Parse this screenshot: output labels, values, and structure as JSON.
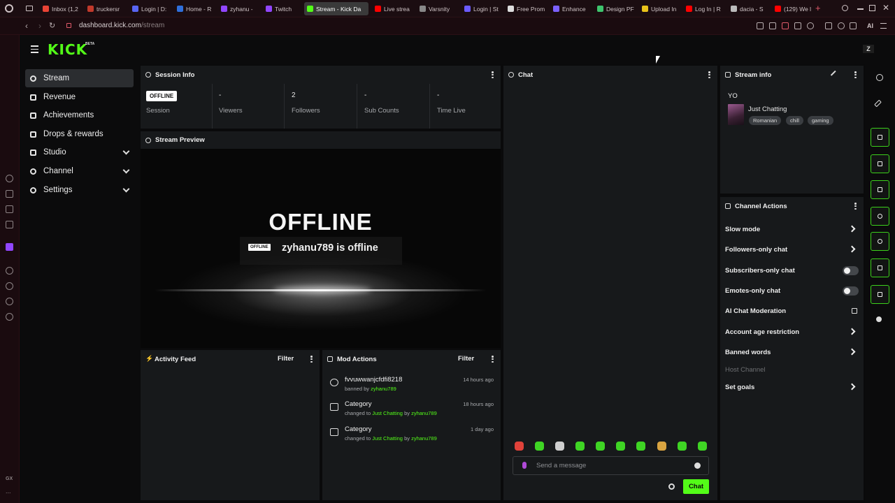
{
  "browser": {
    "tabs": [
      {
        "label": "Inbox (1,2",
        "color": "#ea4335"
      },
      {
        "label": "truckersr",
        "color": "#c0392b"
      },
      {
        "label": "Login | D:",
        "color": "#5865f2"
      },
      {
        "label": "Home - R",
        "color": "#2f6fdb"
      },
      {
        "label": "zyhanu -",
        "color": "#9146ff"
      },
      {
        "label": "Twitch",
        "color": "#9146ff"
      },
      {
        "label": "Stream - Kick Da",
        "color": "#53fc18"
      },
      {
        "label": "Live strea",
        "color": "#ff0000"
      },
      {
        "label": "Varsnity",
        "color": "#888888"
      },
      {
        "label": "Login | St",
        "color": "#6b5bff"
      },
      {
        "label": "Free Prom",
        "color": "#dddddd"
      },
      {
        "label": "Enhance",
        "color": "#7b61ff"
      },
      {
        "label": "Design PF",
        "color": "#3ec46d"
      },
      {
        "label": "Upload In",
        "color": "#e8c21a"
      },
      {
        "label": "Log In | R",
        "color": "#ff0000"
      },
      {
        "label": "dacia - S",
        "color": "#bbbbbb"
      },
      {
        "label": "(129) We l",
        "color": "#ff0000"
      }
    ],
    "new_tab": "+",
    "url_host": "dashboard.kick.com",
    "url_path": "/stream",
    "ai_label": "AI"
  },
  "opera": {
    "gx": "GX",
    "more": "..."
  },
  "header": {
    "logo": "KICK",
    "beta": "BETA",
    "avatar": "Z"
  },
  "nav": {
    "items": [
      {
        "label": "Stream"
      },
      {
        "label": "Revenue"
      },
      {
        "label": "Achievements"
      },
      {
        "label": "Drops & rewards"
      },
      {
        "label": "Studio"
      },
      {
        "label": "Channel"
      },
      {
        "label": "Settings"
      }
    ]
  },
  "session": {
    "title": "Session Info",
    "badge": "OFFLINE",
    "stats": [
      {
        "value": "",
        "label": "Session"
      },
      {
        "value": "-",
        "label": "Viewers"
      },
      {
        "value": "2",
        "label": "Followers"
      },
      {
        "value": "-",
        "label": "Sub Counts"
      },
      {
        "value": "-",
        "label": "Time Live"
      }
    ]
  },
  "preview": {
    "title": "Stream Preview",
    "offline_title": "OFFLINE",
    "badge": "OFFLINE",
    "offline_text": "zyhanu789 is offline"
  },
  "activity": {
    "title": "Activity Feed",
    "filter": "Filter"
  },
  "mod": {
    "title": "Mod Actions",
    "filter": "Filter",
    "items": [
      {
        "title": "fvvuwwanjcfdfi8218",
        "prefix": "banned by ",
        "link1": "zyhanu789",
        "mid": "",
        "link2": "",
        "time": "14 hours ago"
      },
      {
        "title": "Category",
        "prefix": "changed to ",
        "link1": "Just Chatting",
        "mid": " by ",
        "link2": "zyhanu789",
        "time": "18 hours ago"
      },
      {
        "title": "Category",
        "prefix": "changed to ",
        "link1": "Just Chatting",
        "mid": " by ",
        "link2": "zyhanu789",
        "time": "1 day ago"
      }
    ]
  },
  "chat": {
    "title": "Chat",
    "placeholder": "Send a message",
    "send": "Chat",
    "emote_count": 10
  },
  "stream_info": {
    "title": "Stream info",
    "stream_title": "YO",
    "category": "Just Chatting",
    "tags": [
      "Romanian",
      "chill",
      "gaming"
    ]
  },
  "channel_actions": {
    "title": "Channel Actions",
    "rows": [
      {
        "label": "Slow mode",
        "control": "chevron"
      },
      {
        "label": "Followers-only chat",
        "control": "chevron"
      },
      {
        "label": "Subscribers-only chat",
        "control": "toggle",
        "on": false
      },
      {
        "label": "Emotes-only chat",
        "control": "toggle",
        "on": false
      },
      {
        "label": "AI Chat Moderation",
        "control": "external"
      },
      {
        "label": "Account age restriction",
        "control": "chevron"
      },
      {
        "label": "Banned words",
        "control": "chevron"
      },
      {
        "label": "Host Channel",
        "control": "disabled"
      },
      {
        "label": "Set goals",
        "control": "chevron"
      }
    ]
  },
  "colors": {
    "accent": "#53fc18",
    "panel": "#17191b",
    "background": "#0b0b0c"
  }
}
